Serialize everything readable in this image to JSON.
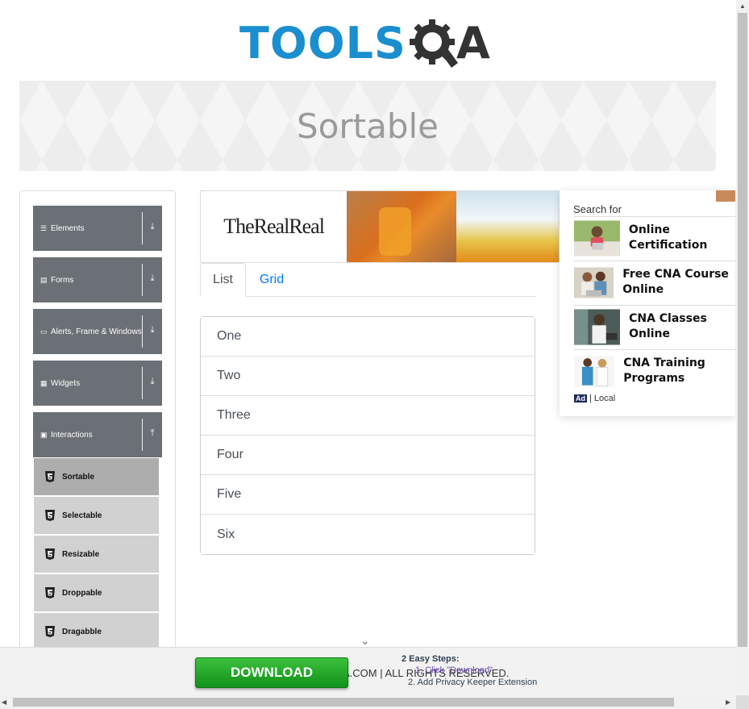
{
  "logo": {
    "part1": "TOOLS",
    "part2": "A"
  },
  "banner": {
    "title": "Sortable"
  },
  "sidebar": {
    "groups": [
      {
        "label": "Elements",
        "icon": "list-icon",
        "arrow": "⤓"
      },
      {
        "label": "Forms",
        "icon": "form-icon",
        "arrow": "⤓"
      },
      {
        "label": "Alerts, Frame & Windows",
        "icon": "window-icon",
        "arrow": "⤓"
      },
      {
        "label": "Widgets",
        "icon": "grid-icon",
        "arrow": "⤓"
      },
      {
        "label": "Interactions",
        "icon": "interaction-icon",
        "arrow": "⤒"
      }
    ],
    "subitems": [
      {
        "label": "Sortable",
        "active": true
      },
      {
        "label": "Selectable"
      },
      {
        "label": "Resizable"
      },
      {
        "label": "Droppable"
      },
      {
        "label": "Dragabble"
      }
    ]
  },
  "ad_top": {
    "brand": "TheRealReal"
  },
  "tabs": [
    {
      "label": "List",
      "active": true
    },
    {
      "label": "Grid"
    }
  ],
  "list_items": [
    "One",
    "Two",
    "Three",
    "Four",
    "Five",
    "Six"
  ],
  "side_ad": {
    "search_for": "Search for",
    "items": [
      "Online Certification",
      "Free CNA Course Online",
      "CNA Classes Online",
      "CNA Training Programs"
    ],
    "badge": "Ad",
    "footer": "| Local"
  },
  "bottom_bar": {
    "footer_text": "A.COM | ALL RIGHTS RESERVED.",
    "download_label": "DOWNLOAD",
    "steps_title": "2 Easy Steps:",
    "step1": "1. Click \"Download\"",
    "step2": "2. Add Privacy Keeper Extension"
  },
  "colors": {
    "accent_blue": "#1b8ecf",
    "sidebar_gray": "#6b7076",
    "download_green": "#1fa825",
    "link_blue": "#007bff"
  }
}
